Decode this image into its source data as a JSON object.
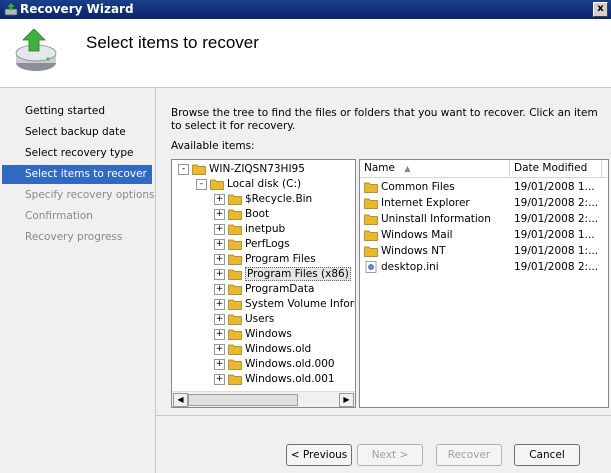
{
  "window": {
    "title": "Recovery Wizard",
    "close_glyph": "x"
  },
  "header": {
    "title": "Select items to recover",
    "icon": "backup-drive-restore-icon"
  },
  "nav": {
    "items": [
      {
        "label": "Getting started",
        "state": "normal"
      },
      {
        "label": "Select backup date",
        "state": "normal"
      },
      {
        "label": "Select recovery type",
        "state": "normal"
      },
      {
        "label": "Select items to recover",
        "state": "active"
      },
      {
        "label": "Specify recovery options",
        "state": "disabled"
      },
      {
        "label": "Confirmation",
        "state": "disabled"
      },
      {
        "label": "Recovery progress",
        "state": "disabled"
      }
    ]
  },
  "main": {
    "description": "Browse the tree to find the files or folders that you want to recover. Click an item to select it for recovery.",
    "available_label": "Available items:"
  },
  "tree": {
    "root": {
      "label": "WIN-ZIQSN73HI95",
      "expander": "-"
    },
    "disk": {
      "label": "Local disk (C:)",
      "expander": "-"
    },
    "folders": [
      {
        "label": "$Recycle.Bin",
        "expander": "+"
      },
      {
        "label": "Boot",
        "expander": "+"
      },
      {
        "label": "inetpub",
        "expander": "+"
      },
      {
        "label": "PerfLogs",
        "expander": "+"
      },
      {
        "label": "Program Files",
        "expander": "+"
      },
      {
        "label": "Program Files (x86)",
        "expander": "+"
      },
      {
        "label": "ProgramData",
        "expander": "+"
      },
      {
        "label": "System Volume Inform",
        "expander": "+"
      },
      {
        "label": "Users",
        "expander": "+"
      },
      {
        "label": "Windows",
        "expander": "+"
      },
      {
        "label": "Windows.old",
        "expander": "+"
      },
      {
        "label": "Windows.old.000",
        "expander": "+"
      },
      {
        "label": "Windows.old.001",
        "expander": "+"
      }
    ],
    "selected_folder": "Program Files (x86)",
    "scroll_left": "◀",
    "scroll_right": "▶"
  },
  "list": {
    "columns": [
      {
        "label": "Name",
        "sort_glyph": "▲"
      },
      {
        "label": "Date Modified"
      }
    ],
    "rows": [
      {
        "name": "Common Files",
        "date": "19/01/2008 1...",
        "icon": "folder-icon"
      },
      {
        "name": "Internet Explorer",
        "date": "19/01/2008 2:...",
        "icon": "folder-icon"
      },
      {
        "name": "Uninstall Information",
        "date": "19/01/2008 2:...",
        "icon": "folder-icon"
      },
      {
        "name": "Windows Mail",
        "date": "19/01/2008 1...",
        "icon": "folder-icon"
      },
      {
        "name": "Windows NT",
        "date": "19/01/2008 1:...",
        "icon": "folder-icon"
      },
      {
        "name": "desktop.ini",
        "date": "19/01/2008 2:...",
        "icon": "settings-file-icon"
      }
    ]
  },
  "buttons": {
    "previous": "< Previous",
    "next": "Next >",
    "recover": "Recover",
    "cancel": "Cancel"
  },
  "colors": {
    "selection": "#316ac5",
    "folder": "#e8b830",
    "title_bar": "#0a246a"
  }
}
